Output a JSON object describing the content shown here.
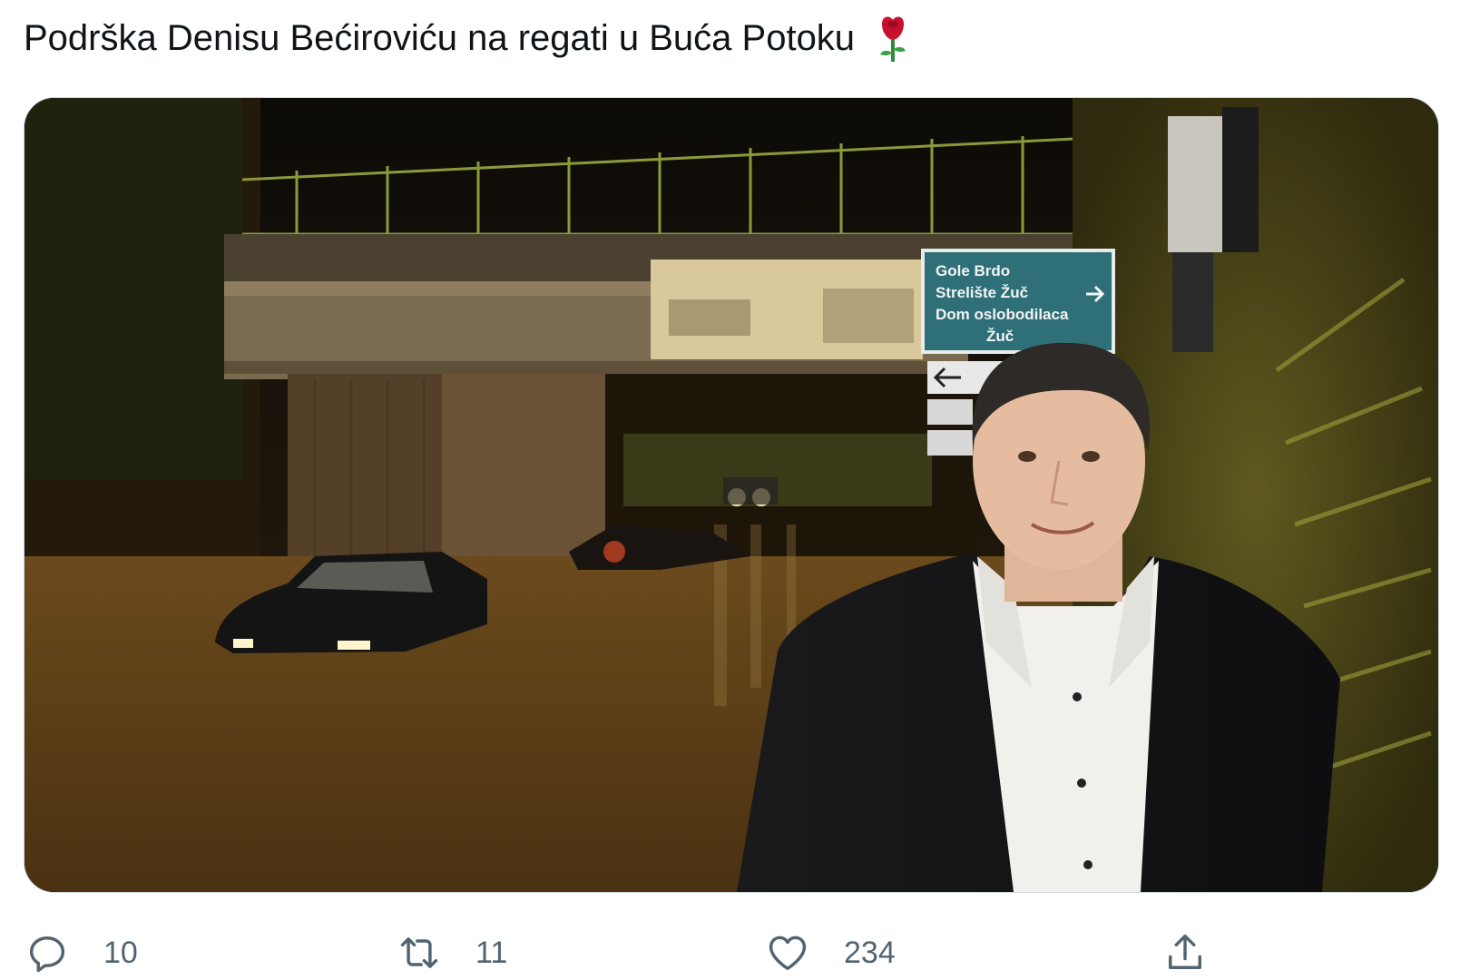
{
  "tweet": {
    "text": "Podrška Denisu Bećiroviću na regati u Buća Potoku",
    "emoji": "rose-icon"
  },
  "media": {
    "sign": {
      "line1": "Gole Brdo",
      "line2": "Strelište Žuč",
      "line3": "Dom oslobodilaca",
      "line4": "Žuč"
    }
  },
  "actions": {
    "reply_count": "10",
    "retweet_count": "11",
    "like_count": "234"
  },
  "colors": {
    "text": "#0f1419",
    "muted": "#536471",
    "border": "#cfd9de"
  }
}
